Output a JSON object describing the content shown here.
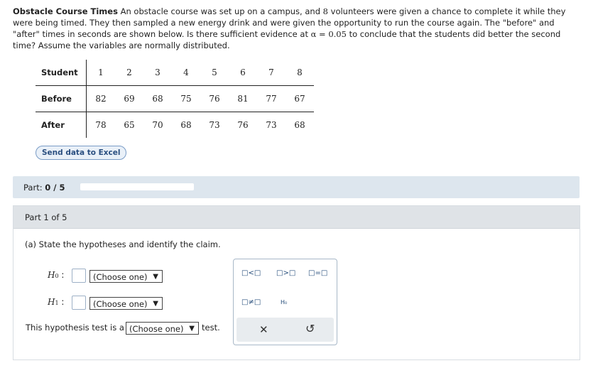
{
  "problem": {
    "title": "Obstacle Course Times",
    "text_a": "An obstacle course was set up on a campus, and",
    "n": "8",
    "text_b": "volunteers were given a chance to complete it while they were being timed. They then sampled a new energy drink and were given the opportunity to run the course again. The \"before\" and \"after\" times in seconds are shown below. Is there sufficient evidence at",
    "alpha": "α = 0.05",
    "text_c": "to conclude that the students did better the second time? Assume the variables are normally distributed."
  },
  "table": {
    "header_label": "Student",
    "students": [
      "1",
      "2",
      "3",
      "4",
      "5",
      "6",
      "7",
      "8"
    ],
    "before_label": "Before",
    "before": [
      "82",
      "69",
      "68",
      "75",
      "76",
      "81",
      "77",
      "67"
    ],
    "after_label": "After",
    "after": [
      "78",
      "65",
      "70",
      "68",
      "73",
      "76",
      "73",
      "68"
    ]
  },
  "excel_button": "Send data to Excel",
  "progress": {
    "label": "Part:",
    "value": "0 / 5",
    "fraction": 0.0
  },
  "part_header": "Part 1 of 5",
  "question": "(a) State the hypotheses and identify the claim.",
  "h0": {
    "symbol": "H",
    "sub": "0",
    "select": "(Choose one)"
  },
  "h1": {
    "symbol": "H",
    "sub": "1",
    "select": "(Choose one)"
  },
  "test_line": {
    "prefix": "This hypothesis test is a",
    "select": "(Choose one)",
    "suffix": "test."
  },
  "palette": {
    "lt": "□<□",
    "gt": "□>□",
    "eq": "□=□",
    "ne": "□≠□",
    "h0": "H₀",
    "clear": "✕",
    "undo": "↺"
  }
}
